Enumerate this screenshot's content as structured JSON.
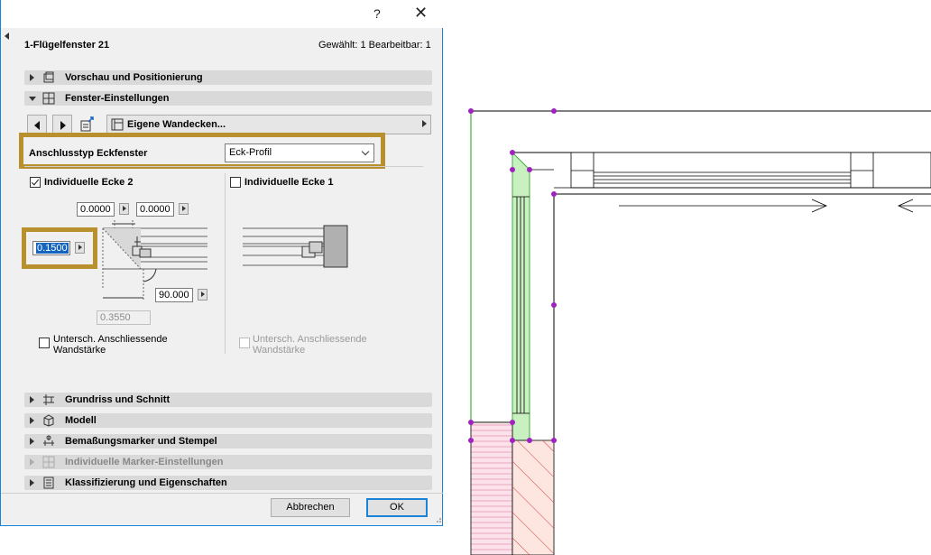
{
  "titlebar": {
    "help": "?",
    "close": "✕"
  },
  "header": {
    "element_name": "1-Flügelfenster 21",
    "selection": "Gewählt: 1 Bearbeitbar: 1"
  },
  "sections_top": [
    {
      "label": "Vorschau und Positionierung",
      "icon": "preview-icon",
      "expanded": false
    },
    {
      "label": "Fenster-Einstellungen",
      "icon": "window-settings-icon",
      "expanded": true
    }
  ],
  "nav": {
    "panel_label": "Eigene Wandecken...",
    "prev": "previous-arrow",
    "next": "next-arrow"
  },
  "corner_type": {
    "label": "Anschlusstyp Eckfenster",
    "value": "Eck-Profil"
  },
  "corner2": {
    "label": "Individuelle Ecke 2",
    "checked": true,
    "field_top_left": "0.0000",
    "field_top_right": "0.0000",
    "field_left": "0.1500",
    "field_angle": "90.000",
    "field_bottom": "0.3550",
    "diff_label": "Untersch. Anschliessende Wandstärke"
  },
  "corner1": {
    "label": "Individuelle Ecke 1",
    "checked": false,
    "diff_label": "Untersch. Anschliessende Wandstärke"
  },
  "sections_bottom": [
    {
      "label": "Grundriss und Schnitt",
      "icon": "floorplan-icon",
      "disabled": false
    },
    {
      "label": "Modell",
      "icon": "model-icon",
      "disabled": false
    },
    {
      "label": "Bemaßungsmarker und Stempel",
      "icon": "dimension-marker-icon",
      "disabled": false
    },
    {
      "label": "Individuelle Marker-Einstellungen",
      "icon": "marker-icon",
      "disabled": true
    },
    {
      "label": "Klassifizierung und Eigenschaften",
      "icon": "classification-icon",
      "disabled": false
    }
  ],
  "buttons": {
    "cancel": "Abbrechen",
    "ok": "OK"
  },
  "colors": {
    "accent": "#1883d7",
    "highlight": "#b8902e",
    "selection_point": "#a020c0",
    "glass_fill": "#c8f0c0",
    "wall_hatch": "#e05050"
  }
}
